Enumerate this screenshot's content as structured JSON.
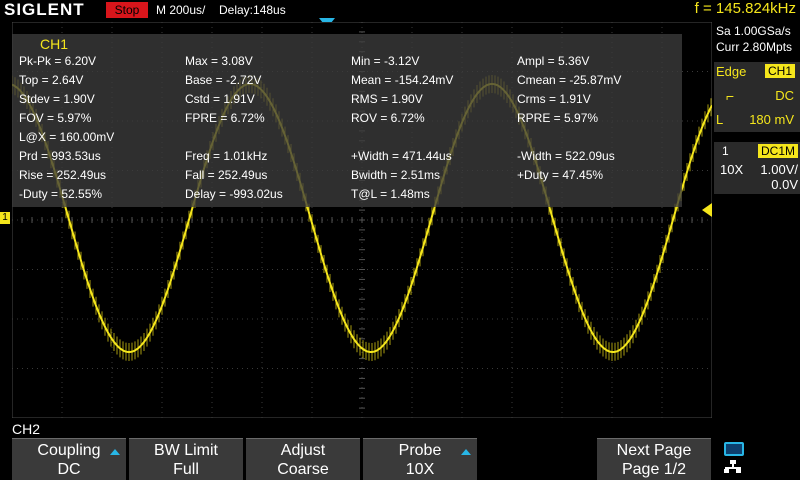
{
  "topbar": {
    "brand": "SIGLENT",
    "run_state": "Stop",
    "timebase": "M 200us/",
    "delay": "Delay:148us",
    "frequency": "f = 145.824kHz"
  },
  "right_panel": {
    "sample_rate": "Sa 1.00GSa/s",
    "memory": "Curr 2.80Mpts",
    "trigger": {
      "mode": "Edge",
      "source": "CH1",
      "coupling": "DC",
      "level_label": "L",
      "level": "180 mV"
    },
    "channel": {
      "num": "1",
      "coupling": "DC1M",
      "probe": "10X",
      "scale": "1.00V/",
      "offset": "0.0V"
    }
  },
  "measurements": {
    "channel": "CH1",
    "rows": [
      [
        "Pk-Pk = 6.20V",
        "Max = 3.08V",
        "Min = -3.12V",
        "Ampl = 5.36V"
      ],
      [
        "Top = 2.64V",
        "Base = -2.72V",
        "Mean = -154.24mV",
        "Cmean = -25.87mV"
      ],
      [
        "Stdev = 1.90V",
        "Cstd = 1.91V",
        "RMS = 1.90V",
        "Crms = 1.91V"
      ],
      [
        "FOV = 5.97%",
        "FPRE = 6.72%",
        "ROV = 6.72%",
        "RPRE = 5.97%"
      ],
      [
        "L@X = 160.00mV",
        "",
        "",
        ""
      ],
      [
        "Prd = 993.53us",
        "Freq = 1.01kHz",
        "+Width = 471.44us",
        "-Width = 522.09us"
      ],
      [
        "Rise = 252.49us",
        "Fall = 252.49us",
        "Bwidth = 2.51ms",
        "+Duty = 47.45%"
      ],
      [
        "-Duty = 52.55%",
        "Delay = -993.02us",
        "T@L = 1.48ms",
        ""
      ]
    ]
  },
  "waveform": {
    "channel_marker": "1",
    "color": "#f5e61c"
  },
  "bottom": {
    "label": "CH2",
    "buttons": [
      {
        "line1": "Coupling",
        "line2": "DC"
      },
      {
        "line1": "BW Limit",
        "line2": "Full"
      },
      {
        "line1": "Adjust",
        "line2": "Coarse"
      },
      {
        "line1": "Probe",
        "line2": "10X"
      },
      {
        "line1": "Next Page",
        "line2": "Page 1/2"
      }
    ]
  }
}
